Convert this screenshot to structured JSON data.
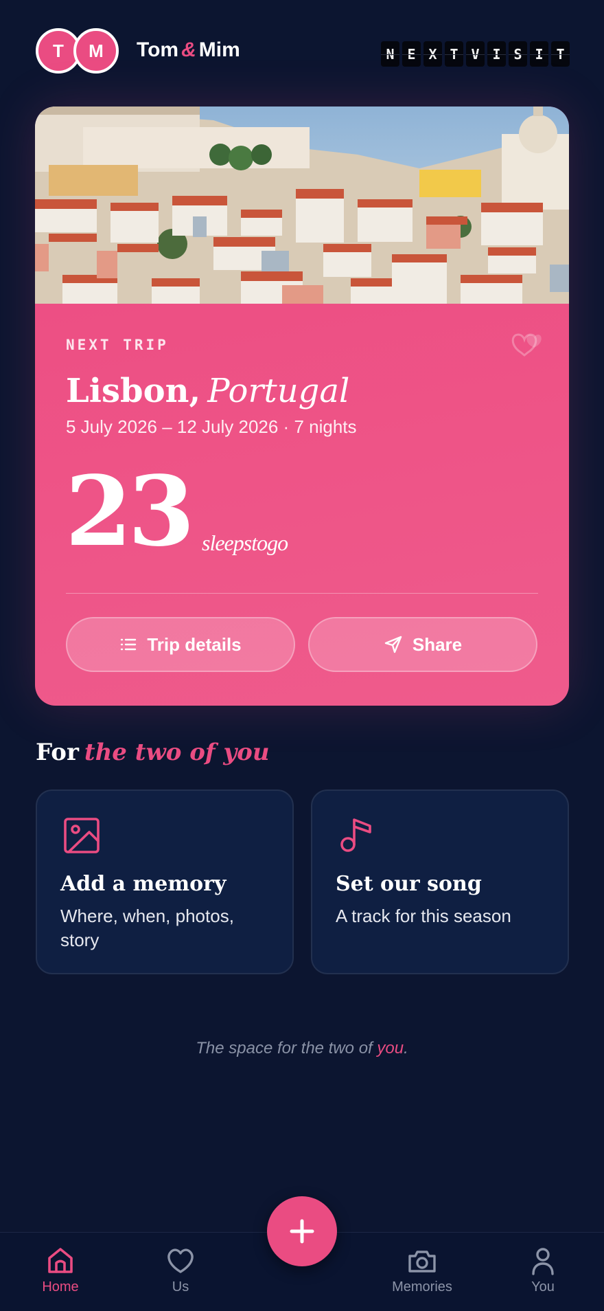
{
  "header": {
    "avatar_1": "T",
    "avatar_2": "M",
    "name_1": "Tom",
    "ampersand": "&",
    "name_2": "Mim",
    "brand_letters": [
      "N",
      "E",
      "X",
      "T",
      "V",
      "I",
      "S",
      "I",
      "T"
    ]
  },
  "trip": {
    "eyebrow": "NEXT TRIP",
    "city": "Lisbon,",
    "country": "Portugal",
    "dates": "5 July 2026 – 12 July 2026 · 7 nights",
    "count": "23",
    "count_suffix": "sleepstogo",
    "details_label": "Trip details",
    "share_label": "Share"
  },
  "section": {
    "title_lead": "For",
    "title_em": "the two of you"
  },
  "tiles": [
    {
      "title": "Add a memory",
      "subtitle": "Where, when, photos, story",
      "icon": "image-icon"
    },
    {
      "title": "Set our song",
      "subtitle": "A track for this season",
      "icon": "music-note-icon"
    }
  ],
  "tagline": {
    "lead": "The space for the two of",
    "highlight": "you",
    "trail": "."
  },
  "tabs": [
    {
      "label": "Home",
      "icon": "home-icon",
      "active": true
    },
    {
      "label": "Us",
      "icon": "heart-icon",
      "active": false
    },
    {
      "label": "Memories",
      "icon": "camera-icon",
      "active": false
    },
    {
      "label": "You",
      "icon": "person-icon",
      "active": false
    }
  ],
  "fab": {
    "icon": "plus-icon"
  },
  "colors": {
    "background": "#0c1530",
    "accent": "#ea4c82",
    "tile": "#0f1f42"
  }
}
